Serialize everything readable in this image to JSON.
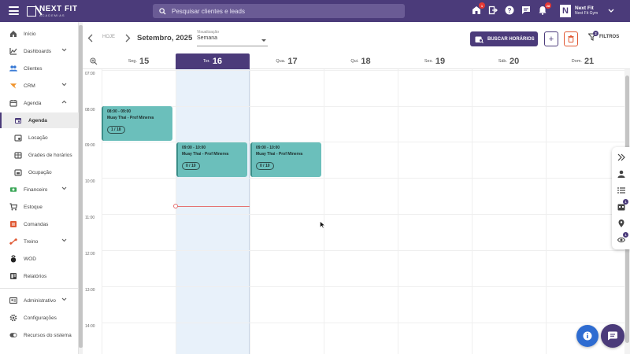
{
  "brand": {
    "name": "NEXT FIT",
    "tagline": "ACADEMIAS"
  },
  "search": {
    "placeholder": "Pesquisar clientes e leads"
  },
  "top_icons": [
    {
      "name": "store-icon",
      "badge": "1"
    },
    {
      "name": "logout-icon",
      "badge": ""
    },
    {
      "name": "help-icon",
      "badge": ""
    },
    {
      "name": "chat-icon",
      "badge": ""
    },
    {
      "name": "notifications-icon",
      "badge": "28"
    }
  ],
  "user": {
    "name": "Next Fit",
    "gym": "Next Fit Gym"
  },
  "sidebar": {
    "items": [
      {
        "label": "Início",
        "icon": "home-icon"
      },
      {
        "label": "Dashboards",
        "icon": "chart-icon"
      },
      {
        "label": "Clientes",
        "icon": "people-icon"
      },
      {
        "label": "CRM",
        "icon": "crm-icon"
      },
      {
        "label": "Agenda",
        "icon": "calendar-icon"
      },
      {
        "label": "Agenda",
        "icon": "calendar-today-icon"
      },
      {
        "label": "Locação",
        "icon": "location-calendar-icon"
      },
      {
        "label": "Grades de horários",
        "icon": "schedule-grid-icon"
      },
      {
        "label": "Ocupação",
        "icon": "occupancy-icon"
      },
      {
        "label": "Financeiro",
        "icon": "money-icon"
      },
      {
        "label": "Estoque",
        "icon": "cart-icon"
      },
      {
        "label": "Comandas",
        "icon": "receipt-icon"
      },
      {
        "label": "Treino",
        "icon": "dumbbell-icon"
      },
      {
        "label": "WOD",
        "icon": "kettlebell-icon"
      },
      {
        "label": "Relatórios",
        "icon": "reports-icon"
      },
      {
        "label": "Administrativo",
        "icon": "admin-icon"
      },
      {
        "label": "Configurações",
        "icon": "settings-icon"
      },
      {
        "label": "Recursos do sistema",
        "icon": "toggle-icon"
      }
    ]
  },
  "toolbar": {
    "today_label": "HOJE",
    "month_label": "Setembro, 2025",
    "view_label": "Visualização",
    "view_value": "Semana",
    "search_schedules": "BUSCAR HORÁRIOS",
    "add_label": "+",
    "filters_label": "FILTROS",
    "filters_badge": "2"
  },
  "calendar": {
    "days": [
      {
        "name": "Seg.",
        "num": "15"
      },
      {
        "name": "Ter.",
        "num": "16"
      },
      {
        "name": "Qua.",
        "num": "17"
      },
      {
        "name": "Qui.",
        "num": "18"
      },
      {
        "name": "Sex.",
        "num": "19"
      },
      {
        "name": "Sáb.",
        "num": "20"
      },
      {
        "name": "Dom.",
        "num": "21"
      }
    ],
    "hours": [
      "07:00",
      "08:00",
      "09:00",
      "10:00",
      "11:00",
      "12:00",
      "13:00",
      "14:00"
    ],
    "events": [
      {
        "day": "Seg.",
        "time": "08:00 - 09:00",
        "title": "Muay Thai - Prof Minerva",
        "count": "1 / 18"
      },
      {
        "day": "Ter.",
        "time": "09:00 - 10:00",
        "title": "Muay Thai - Prof Minerva",
        "count": "0 / 10"
      },
      {
        "day": "Qua.",
        "time": "09:00 - 10:00",
        "title": "Muay Thai - Prof Minerva",
        "count": "0 / 10"
      }
    ]
  },
  "right_panel": {
    "items": [
      {
        "name": "collapse-panel-icon",
        "badge": ""
      },
      {
        "name": "person-icon",
        "badge": ""
      },
      {
        "name": "list-icon",
        "badge": ""
      },
      {
        "name": "calendar-grid-icon",
        "badge": "1"
      },
      {
        "name": "map-pin-icon",
        "badge": ""
      },
      {
        "name": "eye-icon",
        "badge": "1"
      }
    ]
  },
  "colors": {
    "brand": "#4b3b7a",
    "event": "#6bbfbb",
    "today_bg": "#e8f1fa",
    "danger": "#e05a35",
    "info": "#2e6cd1"
  }
}
